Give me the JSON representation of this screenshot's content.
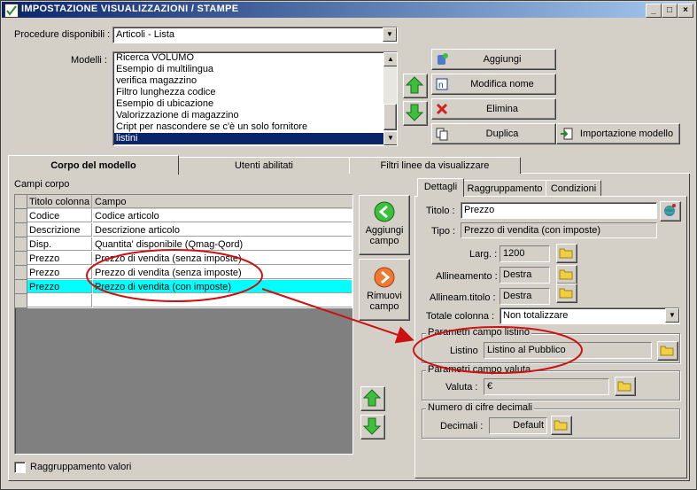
{
  "window": {
    "title": "IMPOSTAZIONE VISUALIZZAZIONI / STAMPE",
    "minimize": "_",
    "maximize": "□",
    "close": "×"
  },
  "top": {
    "procedure_label": "Procedure disponibili :",
    "procedure_value": "Articoli - Lista",
    "modelli_label": "Modelli :",
    "modelli": [
      "Ricerca VOLUMO",
      "Esempio di multilingua",
      "verifica magazzino",
      "Filtro lunghezza codice",
      "Esempio di ubicazione",
      "Valorizzazione di magazzino",
      "Cript per nascondere se c'è un solo fornitore",
      "listini"
    ],
    "buttons": {
      "aggiungi": "Aggiungi",
      "modifica": "Modifica nome",
      "elimina": "Elimina",
      "duplica": "Duplica",
      "importazione": "Importazione modello"
    }
  },
  "tabs": [
    "Corpo del modello",
    "Utenti abilitati",
    "Filtri linee da visualizzare"
  ],
  "corpo": {
    "campi_label": "Campi corpo",
    "columns": [
      "Titolo colonna",
      "Campo"
    ],
    "rows": [
      {
        "titolo": "Codice",
        "campo": "Codice articolo"
      },
      {
        "titolo": "Descrizione",
        "campo": "Descrizione articolo"
      },
      {
        "titolo": "Disp.",
        "campo": "Quantita' disponibile (Qmag-Qord)"
      },
      {
        "titolo": "Prezzo",
        "campo": "Prezzo di vendita (senza imposte)"
      },
      {
        "titolo": "Prezzo",
        "campo": "Prezzo di vendita (senza imposte)"
      },
      {
        "titolo": "Prezzo",
        "campo": "Prezzo di vendita (con imposte)"
      }
    ],
    "aggiungi_campo": [
      "Aggiungi",
      "campo"
    ],
    "rimuovi_campo": [
      "Rimuovi",
      "campo"
    ],
    "raggruppamento_label": "Raggruppamento valori"
  },
  "detail_tabs": [
    "Dettagli",
    "Raggruppamento",
    "Condizioni"
  ],
  "dettagli": {
    "titolo_label": "Titolo :",
    "titolo_value": "Prezzo",
    "tipo_label": "Tipo :",
    "tipo_value": "Prezzo di vendita (con imposte)",
    "larg_label": "Larg. :",
    "larg_value": "1200",
    "allineamento_label": "Allineamento :",
    "allineamento_value": "Destra",
    "allineam_titolo_label": "Allineam.titolo :",
    "allineam_titolo_value": "Destra",
    "totale_label": "Totale colonna :",
    "totale_value": "Non totalizzare",
    "listino_group": "Parametri campo listino",
    "listino_label": "Listino",
    "listino_value": "Listino al Pubblico",
    "valuta_group": "Parametri campo valuta",
    "valuta_label": "Valuta :",
    "valuta_value": "€",
    "decimali_group": "Numero di cifre decimali",
    "decimali_label": "Decimali :",
    "decimali_value": "Default"
  },
  "colors": {
    "highlight_row": "#00ffff",
    "annotation": "#cc1111",
    "selection": "#0a246a"
  }
}
